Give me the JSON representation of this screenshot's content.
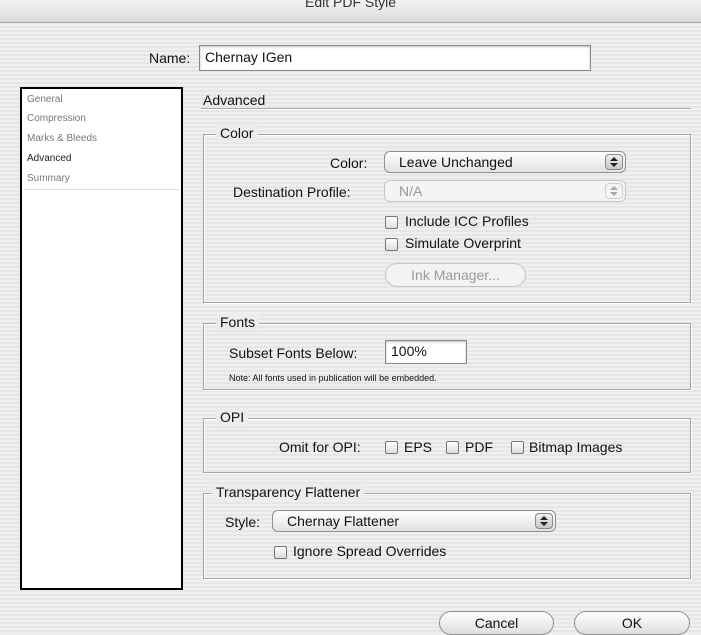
{
  "window": {
    "title": "Edit PDF Style"
  },
  "name": {
    "label": "Name:",
    "value": "Chernay IGen"
  },
  "sidebar": {
    "items": [
      {
        "label": "General",
        "selected": false
      },
      {
        "label": "Compression",
        "selected": false
      },
      {
        "label": "Marks & Bleeds",
        "selected": false
      },
      {
        "label": "Advanced",
        "selected": true
      },
      {
        "label": "Summary",
        "selected": false
      }
    ]
  },
  "panel": {
    "title": "Advanced"
  },
  "color_group": {
    "title": "Color",
    "color_label": "Color:",
    "color_value": "Leave Unchanged",
    "dest_label": "Destination Profile:",
    "dest_value": "N/A",
    "include_icc": {
      "label": "Include ICC Profiles",
      "checked": false
    },
    "simulate_overprint": {
      "label": "Simulate Overprint",
      "checked": false
    },
    "ink_manager": "Ink Manager..."
  },
  "fonts_group": {
    "title": "Fonts",
    "subset_label": "Subset Fonts Below:",
    "subset_value": "100%",
    "note": "Note:  All fonts used in publication will be embedded."
  },
  "opi_group": {
    "title": "OPI",
    "omit_label": "Omit for OPI:",
    "eps": {
      "label": "EPS",
      "checked": false
    },
    "pdf": {
      "label": "PDF",
      "checked": false
    },
    "bitmap": {
      "label": "Bitmap Images",
      "checked": false
    }
  },
  "transparency_group": {
    "title": "Transparency Flattener",
    "style_label": "Style:",
    "style_value": "Chernay Flattener",
    "ignore_spread": {
      "label": "Ignore Spread Overrides",
      "checked": false
    }
  },
  "buttons": {
    "cancel": "Cancel",
    "ok": "OK"
  }
}
